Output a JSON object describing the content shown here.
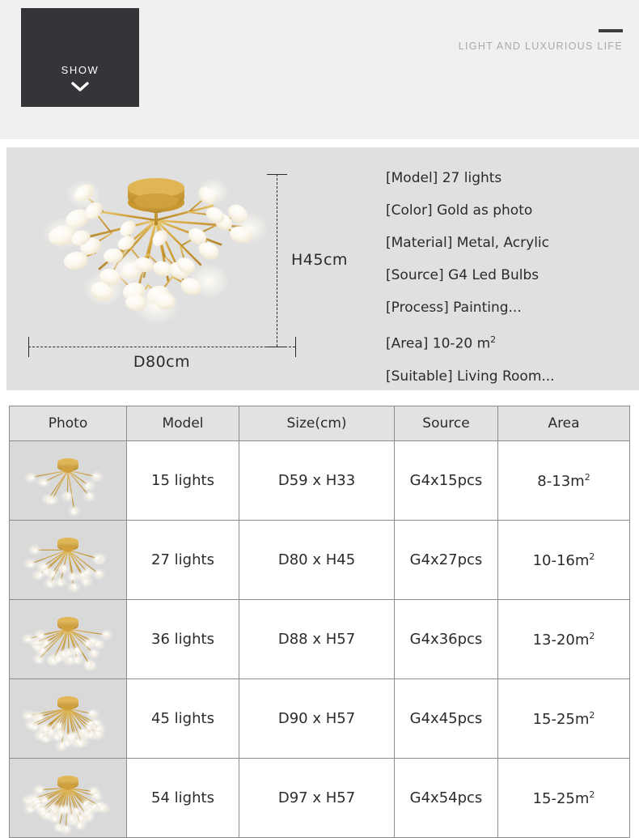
{
  "header": {
    "show_label": "SHOW",
    "show_icon": "chevron-down-icon",
    "tagline": "LIGHT AND LUXURIOUS LIFE"
  },
  "spec_panel": {
    "dimension_width_label": "D80cm",
    "dimension_height_label": "H45cm",
    "specs": [
      {
        "key": "[Model]",
        "value": "27 lights"
      },
      {
        "key": "[Color]",
        "value": "Gold as photo"
      },
      {
        "key": "[Material]",
        "value": "Metal, Acrylic"
      },
      {
        "key": "[Source]",
        "value": "G4 Led Bulbs"
      },
      {
        "key": "[Process]",
        "value": "Painting..."
      },
      {
        "key": "[Area]",
        "value": "10-20 m",
        "sup": "2"
      },
      {
        "key": "[Suitable]",
        "value": "Living Room..."
      }
    ]
  },
  "table": {
    "columns": [
      "Photo",
      "Model",
      "Size(cm)",
      "Source",
      "Area"
    ],
    "rows": [
      {
        "photo": "chandelier-15-lights",
        "model": "15 lights",
        "size": "D59 x H33",
        "source": "G4x15pcs",
        "area": "8-13m",
        "area_sup": "2",
        "arms": 15
      },
      {
        "photo": "chandelier-27-lights",
        "model": "27 lights",
        "size": "D80 x H45",
        "source": "G4x27pcs",
        "area": "10-16m",
        "area_sup": "2",
        "arms": 27
      },
      {
        "photo": "chandelier-36-lights",
        "model": "36 lights",
        "size": "D88 x H57",
        "source": "G4x36pcs",
        "area": "13-20m",
        "area_sup": "2",
        "arms": 36
      },
      {
        "photo": "chandelier-45-lights",
        "model": "45 lights",
        "size": "D90 x H57",
        "source": "G4x45pcs",
        "area": "15-25m",
        "area_sup": "2",
        "arms": 45
      },
      {
        "photo": "chandelier-54-lights",
        "model": "54 lights",
        "size": "D97 x H57",
        "source": "G4x54pcs",
        "area": "15-25m",
        "area_sup": "2",
        "arms": 54
      }
    ]
  },
  "colors": {
    "header_bg": "#f0f0f0",
    "show_block_bg": "#333538",
    "spec_panel_bg": "#e0e0e0",
    "photo_cell_bg": "#d9d9d9",
    "table_header_bg": "#e2e2e2",
    "table_border": "#8c8c8c",
    "gold": "#c9972f",
    "gold_light": "#e8c56a",
    "tagline": "#a9a9a9",
    "text": "#2b2b2b"
  }
}
